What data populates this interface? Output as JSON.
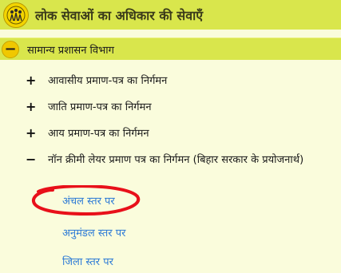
{
  "header": {
    "title": "लोक सेवाओं का अधिकार की सेवाएँ",
    "logo_icon": "emblem-icon"
  },
  "department": {
    "toggle": "−",
    "title": "सामान्य प्रशासन विभाग"
  },
  "services": [
    {
      "sign": "+",
      "label": "आवासीय प्रमाण-पत्र का निर्गमन"
    },
    {
      "sign": "+",
      "label": "जाति प्रमाण-पत्र का निर्गमन"
    },
    {
      "sign": "+",
      "label": "आय प्रमाण-पत्र का निर्गमन"
    },
    {
      "sign": "−",
      "label": "नॉन क्रीमी लेयर प्रमाण पत्र का निर्गमन (बिहार सरकार के प्रयोजनार्थ)"
    }
  ],
  "sub_levels": [
    "अंचल स्तर पर",
    "अनुमंडल स्तर पर",
    "जिला स्तर पर"
  ],
  "colors": {
    "header_bg": "#d9e64c",
    "page_bg": "#fafcdc",
    "link": "#2e7bd6",
    "highlight": "#e8101a"
  }
}
